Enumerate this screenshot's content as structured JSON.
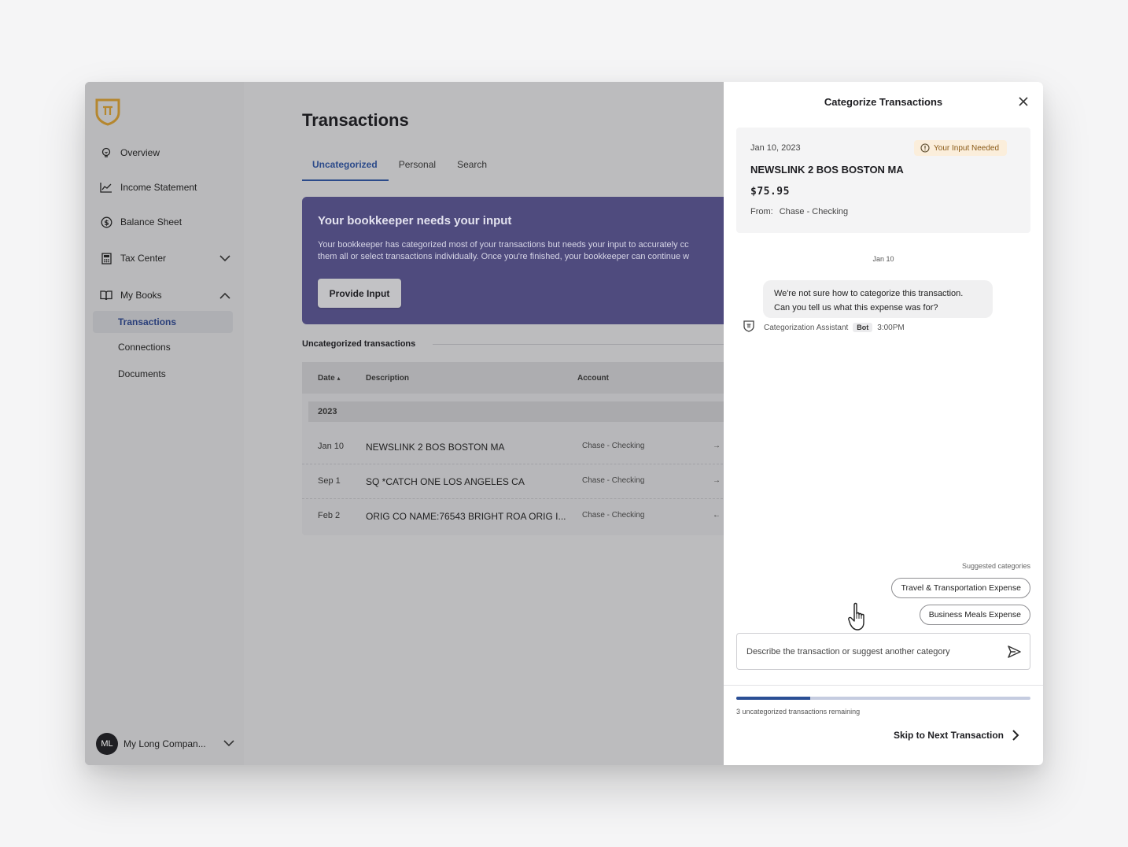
{
  "sidebar": {
    "logo_icon": "brand-shield-icon",
    "items": [
      {
        "label": "Overview",
        "icon": "lightbulb-icon"
      },
      {
        "label": "Income Statement",
        "icon": "line-chart-icon"
      },
      {
        "label": "Balance Sheet",
        "icon": "dollar-circle-icon"
      },
      {
        "label": "Tax Center",
        "icon": "calculator-icon"
      },
      {
        "label": "My Books",
        "icon": "book-icon"
      }
    ],
    "sub_items": [
      {
        "label": "Transactions",
        "active": true
      },
      {
        "label": "Connections",
        "active": false
      },
      {
        "label": "Documents",
        "active": false
      }
    ],
    "account": {
      "initials": "ML",
      "name": "My Long Compan..."
    }
  },
  "main": {
    "title": "Transactions",
    "tabs": [
      {
        "label": "Uncategorized",
        "active": true
      },
      {
        "label": "Personal",
        "active": false
      },
      {
        "label": "Search",
        "active": false
      }
    ],
    "banner": {
      "title": "Your bookkeeper needs your input",
      "text_line1": "Your bookkeeper has categorized most of your transactions but needs your input to accurately cc",
      "text_line2": "them all or select transactions individually. Once you're finished, your bookkeeper can continue w",
      "button": "Provide Input"
    },
    "section_title": "Uncategorized transactions",
    "table": {
      "headers": {
        "date": "Date",
        "description": "Description",
        "account": "Account"
      },
      "sort_indicator": "▴",
      "year": "2023",
      "rows": [
        {
          "date": "Jan 10",
          "description": "NEWSLINK 2 BOS BOSTON MA",
          "account": "Chase - Checking",
          "direction": "→"
        },
        {
          "date": "Sep 1",
          "description": "SQ *CATCH ONE LOS ANGELES CA",
          "account": "Chase - Checking",
          "direction": "→"
        },
        {
          "date": "Feb 2",
          "description": "ORIG CO NAME:76543 BRIGHT ROA ORIG I...",
          "account": "Chase - Checking",
          "direction": "←"
        }
      ]
    }
  },
  "panel": {
    "title": "Categorize Transactions",
    "close_icon": "close-icon",
    "transaction": {
      "date": "Jan 10, 2023",
      "badge": "Your Input Needed",
      "name": "NEWSLINK 2 BOS BOSTON MA",
      "amount": "$75.95",
      "from_label": "From:",
      "from_value": "Chase - Checking"
    },
    "chat": {
      "date": "Jan 10",
      "message_line1": "We're not sure how to categorize this transaction.",
      "message_line2": "Can you tell us what this expense was for?",
      "sender": "Categorization Assistant",
      "sender_tag": "Bot",
      "time": "3:00PM"
    },
    "suggestions": {
      "label": "Suggested categories",
      "items": [
        "Travel & Transportation Expense",
        "Business Meals Expense"
      ]
    },
    "composer": {
      "placeholder": "Describe the transaction or suggest another category",
      "send_icon": "send-icon"
    },
    "progress": {
      "fraction": 0.25
    },
    "remaining_text": "3 uncategorized transactions remaining",
    "skip_label": "Skip to Next Transaction"
  },
  "colors": {
    "accent": "#2b4a8a",
    "banner": "#4f4b7e",
    "badge_bg": "#fbeedb",
    "badge_text": "#8a5a17",
    "logo": "#b5872f"
  }
}
